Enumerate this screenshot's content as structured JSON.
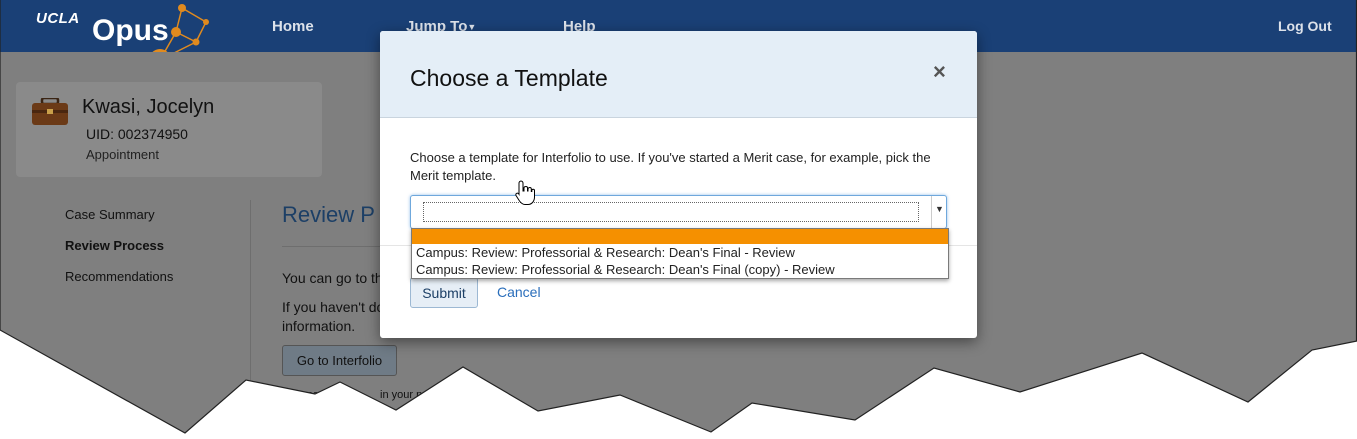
{
  "navbar": {
    "logo_ucla": "UCLA",
    "logo_opus": "Opus",
    "home": "Home",
    "jump_to": "Jump To",
    "help": "Help",
    "logout": "Log Out"
  },
  "profile": {
    "name": "Kwasi, Jocelyn",
    "uid": "UID: 002374950",
    "subtitle": "Appointment"
  },
  "sidebar": {
    "items": [
      {
        "label": "Case Summary",
        "active": false
      },
      {
        "label": "Review Process",
        "active": true
      },
      {
        "label": "Recommendations",
        "active": false
      }
    ]
  },
  "main": {
    "title": "Review P",
    "para1": "You can go to th",
    "para2_line1": "If you haven't do",
    "para2_line2": "information.",
    "goto_button": "Go to Interfolio",
    "popup_note": "You ma                    in your pop up blocker."
  },
  "modal": {
    "title": "Choose a Template",
    "close": "×",
    "description": "Choose a template for Interfolio to use. If you've started a Merit case, for example, pick the Merit template.",
    "select_value": "",
    "options": [
      "",
      "Campus: Review: Professorial & Research: Dean's Final - Review",
      "Campus: Review: Professorial & Research: Dean's Final (copy) - Review"
    ],
    "submit": "Submit",
    "cancel": "Cancel"
  },
  "colors": {
    "navbar": "#1a4076",
    "highlight": "#f59000",
    "logo_orange": "#e08a1e",
    "link": "#2a6ebb"
  }
}
